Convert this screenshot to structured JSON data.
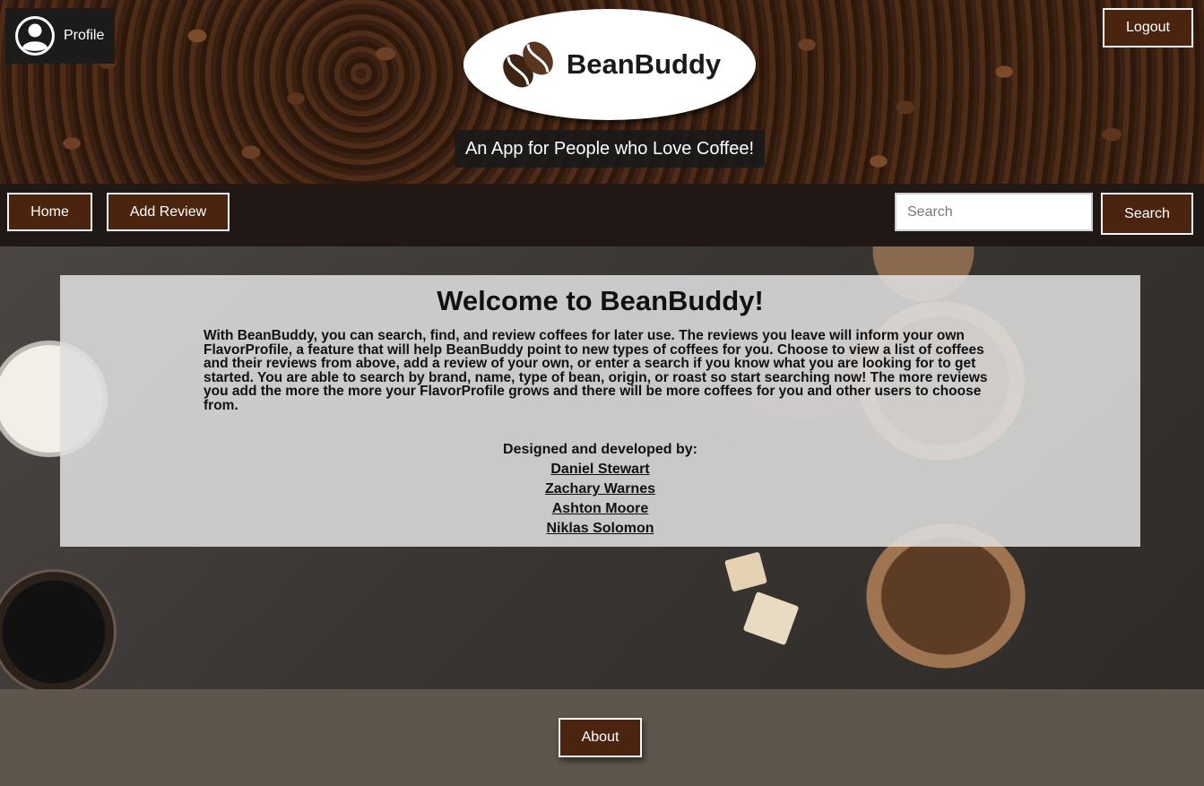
{
  "header": {
    "profile_label": "Profile",
    "logout_label": "Logout",
    "app_name": "BeanBuddy",
    "tagline": "An App for People who Love Coffee!"
  },
  "nav": {
    "home_label": "Home",
    "add_review_label": "Add Review",
    "search_placeholder": "Search",
    "search_value": "",
    "search_button_label": "Search"
  },
  "main": {
    "welcome_title": "Welcome to BeanBuddy!",
    "intro": "With BeanBuddy, you can search, find, and review coffees for later use. The reviews you leave will inform your own FlavorProfile, a feature that will help BeanBuddy point to new types of coffees for you. Choose to view a list of coffees and their reviews from above, add a review of your own, or enter a search if you know what you are looking for to get started. You are able to search by brand, name, type of bean, origin, or roast so start searching now! The more reviews you add the more the more your FlavorProfile grows and there will be more coffees for you and other users to choose from.",
    "credits_title": "Designed and developed by:",
    "developers": [
      "Daniel Stewart",
      "Zachary Warnes",
      "Ashton Moore",
      "Niklas Solomon"
    ]
  },
  "footer": {
    "about_label": "About"
  },
  "colors": {
    "button_bg": "#4b2410",
    "button_border": "#f3f3f3",
    "panel_bg": "#dedede",
    "footer_bg": "#5e554c"
  },
  "icons": {
    "profile": "user-circle-icon",
    "logo": "coffee-beans-icon"
  }
}
